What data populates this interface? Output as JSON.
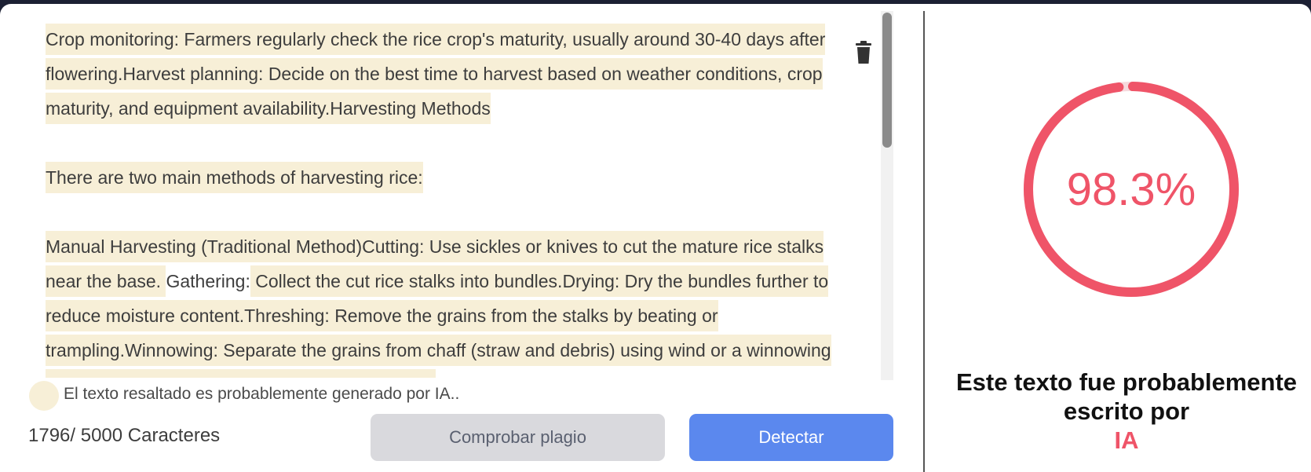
{
  "editor": {
    "paragraph1": "Crop monitoring: Farmers regularly check the rice crop's maturity, usually around 30-40 days after flowering.Harvest planning: Decide on the best time to harvest based on weather conditions, crop maturity, and equipment availability.Harvesting Methods",
    "paragraph2": "There are two main methods of harvesting rice:",
    "paragraph3_part1": "Manual Harvesting (Traditional Method)Cutting: Use sickles or knives to cut the mature rice stalks near the base. ",
    "paragraph3_part2": "Gathering:",
    "paragraph3_part3": " Collect the cut rice stalks into bundles.Drying: Dry the bundles further to reduce moisture content.Threshing: Remove the grains from the stalks by beating or trampling.Winnowing: Separate the grains from chaff (straw and debris) using wind or a winnowing basket.Mechanized Harvesting (Modern Method)",
    "highlight_color": "#f7efd7"
  },
  "legend": {
    "text": "El texto resaltado es probablemente generado por IA.."
  },
  "counter": {
    "text": "1796/ 5000 Caracteres"
  },
  "buttons": {
    "plagiarism_label": "Comprobar plagio",
    "detect_label": "Detectar"
  },
  "result": {
    "percentage": 98.3,
    "percentage_label": "98.3%",
    "verdict_line": "Este texto fue probablemente escrito por",
    "verdict_accent": "IA",
    "accent_color": "#ef5468"
  },
  "icons": {
    "delete": "trash-icon"
  }
}
